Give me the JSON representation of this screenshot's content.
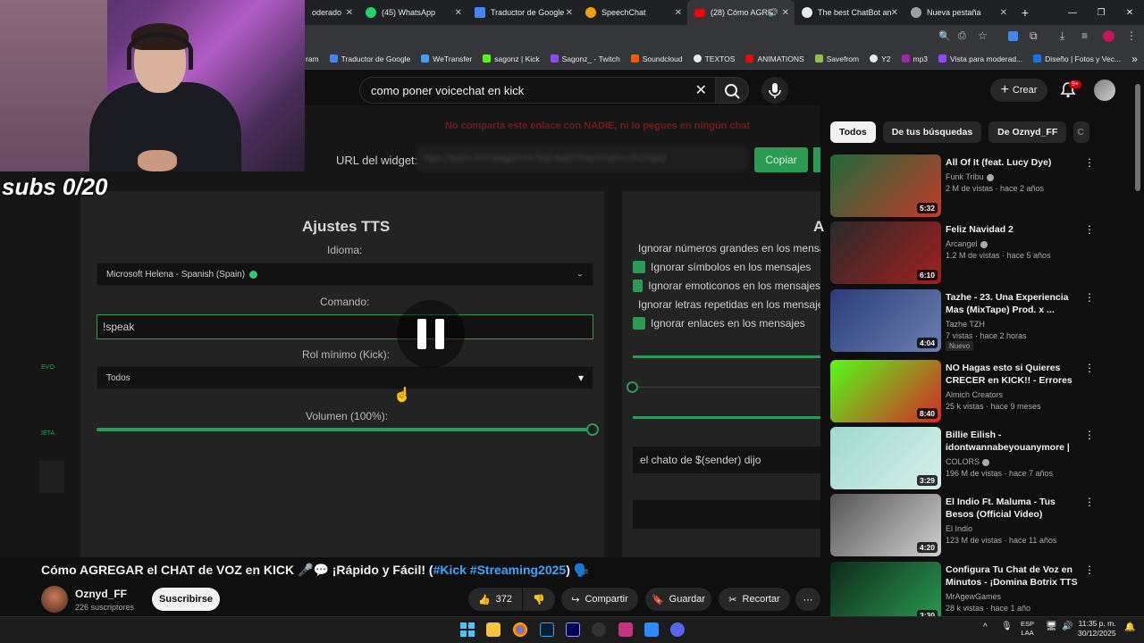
{
  "browser": {
    "tabs": [
      {
        "label": "oderado",
        "favicon_color": "#8b5cf6"
      },
      {
        "label": "(45) WhatsApp",
        "favicon_color": "#25d366"
      },
      {
        "label": "Traductor de Google",
        "favicon_color": "#4285f4"
      },
      {
        "label": "SpeechChat",
        "favicon_color": "#f59e0b"
      },
      {
        "label": "(28) Cómo AGRE",
        "favicon_color": "#ff0000",
        "active": true
      },
      {
        "label": "The best ChatBot an",
        "favicon_color": "#9aa0a6"
      },
      {
        "label": "Nueva pestaña",
        "favicon_color": "#9aa0a6"
      }
    ],
    "bookmarks": [
      {
        "label": "ram",
        "color": "#e1306c"
      },
      {
        "label": "Traductor de Google",
        "color": "#4285f4"
      },
      {
        "label": "WeTransfer",
        "color": "#409fff"
      },
      {
        "label": "sagonz | Kick",
        "color": "#53fc18"
      },
      {
        "label": "Sagonz_ - Twitch",
        "color": "#9146ff"
      },
      {
        "label": "Soundcloud",
        "color": "#ff5500"
      },
      {
        "label": "TEXTOS",
        "color": "#e8eaed"
      },
      {
        "label": "ANIMATIONS",
        "color": "#ff0000"
      },
      {
        "label": "Savefrom",
        "color": "#8bc34a"
      },
      {
        "label": "Y2",
        "color": "#e8eaed"
      },
      {
        "label": "mp3",
        "color": "#9c27b0"
      },
      {
        "label": "Vista para moderad...",
        "color": "#9146ff"
      },
      {
        "label": "Diseño | Fotos y Vec...",
        "color": "#1273eb"
      }
    ]
  },
  "overlay": {
    "subs_text": "subs 0/20"
  },
  "youtube": {
    "search_value": "como poner voicechat en kick",
    "create_label": "Crear",
    "notif_count": "9+",
    "chips": [
      "Todos",
      "De tus búsquedas",
      "De Oznyd_FF",
      "C"
    ],
    "video": {
      "warning": "No comparta este enlace con NADIE, ni lo pegues en ningún chat",
      "url_label": "URL del widget:",
      "url_value": "https://botrix.live/widgets/tts?bid=8a6f7f0ace32d01c3f429ga4",
      "copy_label": "Copiar",
      "tts_title": "Ajustes TTS",
      "language_label": "Idioma:",
      "language_value": "Microsoft Helena - Spanish (Spain)",
      "command_label": "Comando:",
      "command_value": "!speak",
      "role_label": "Rol mínimo (Kick):",
      "role_value": "Todos",
      "volume_label": "Volumen (100%):",
      "volume_level": 1.0,
      "right_heading": "A",
      "checks": [
        "Ignorar números grandes en los mensajes",
        "Ignorar símbolos en los mensajes",
        "Ignorar emoticonos en los mensajes",
        "Ignorar letras repetidas en los mensajes",
        "Ignorar enlaces en los mensajes"
      ],
      "message_template": "el chato de $(sender) dijo",
      "side_label_1": "EVO",
      "side_label_2": "IETA"
    },
    "title_main": "Cómo AGREGAR el CHAT de VOZ en KICK 🎤💬 ¡Rápido y Fácil! (",
    "title_tags": "#Kick #Streaming2025",
    "title_end": ") 🗣️",
    "channel_name": "Oznyd_FF",
    "channel_subs": "226 suscriptores",
    "subscribe_label": "Suscribirse",
    "likes": "372",
    "share_label": "Compartir",
    "save_label": "Guardar",
    "clip_label": "Recortar",
    "recommendations": [
      {
        "title": "All Of It (feat. Lucy Dye)",
        "channel": "Funk Tribu",
        "meta": "2 M de vistas · hace 2 años",
        "duration": "5:32",
        "c1": "#1e6b3a",
        "c2": "#c23a2a",
        "verified": true
      },
      {
        "title": "Feliz Navidad 2",
        "channel": "Arcangel",
        "meta": "1.2 M de vistas · hace 5 años",
        "duration": "6:10",
        "c1": "#2a2a2a",
        "c2": "#a12020",
        "verified": true
      },
      {
        "title": "Tazhe - 23. Una Experiencia Mas (MixTape) Prod. x ...",
        "channel": "Tazhe TZH",
        "meta": "7 vistas · hace 2 horas",
        "duration": "4:04",
        "c1": "#2a3d7a",
        "c2": "#6a7fb0",
        "badge": "Nuevo"
      },
      {
        "title": "NO Hagas esto si Quieres CRECER en KICK!! - Errores m...",
        "channel": "Almich Creators",
        "meta": "25 k vistas · hace 9 meses",
        "duration": "8:40",
        "c1": "#53fc18",
        "c2": "#d62828"
      },
      {
        "title": "Billie Eilish - idontwannabeyouanymore | A ...",
        "channel": "COLORS",
        "meta": "196 M de vistas · hace 7 años",
        "duration": "3:29",
        "c1": "#9fd9d0",
        "c2": "#d5efe9",
        "verified": true
      },
      {
        "title": "El Indio Ft. Maluma - Tus Besos (Official Video)",
        "channel": "El Indio",
        "meta": "123 M de vistas · hace 11 años",
        "duration": "4:20",
        "c1": "#555555",
        "c2": "#cfcfcf"
      },
      {
        "title": "Configura Tu Chat de Voz en Minutos - ¡Domina Botrix TTS ...",
        "channel": "MrAgewGames",
        "meta": "28 k vistas · hace 1 año",
        "duration": "3:30",
        "c1": "#0e2a1a",
        "c2": "#2b9a52"
      }
    ]
  },
  "taskbar": {
    "lang_line1": "ESP",
    "lang_line2": "LAA",
    "time": "11:35 p. m.",
    "date": "30/12/2025"
  }
}
